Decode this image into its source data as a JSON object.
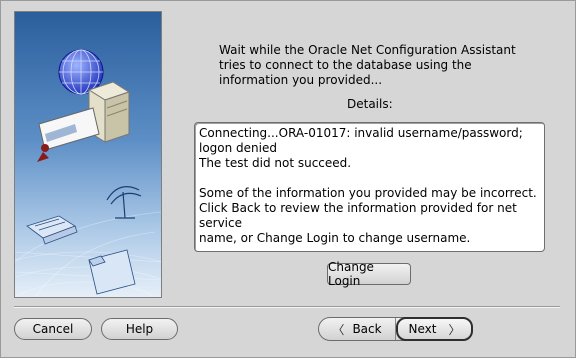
{
  "dialog": {
    "message": "Wait while the Oracle Net Configuration Assistant tries to connect to the database using the information you provided...",
    "details_label": "Details:",
    "details_text": "Connecting...ORA-01017: invalid username/password;\nlogon denied\nThe test did not succeed.\n\nSome of the information you provided may be incorrect.\nClick Back to review the information provided for net service\nname, or Change Login to change username.",
    "change_login_label": "Change Login"
  },
  "footer": {
    "cancel_label": "Cancel",
    "help_label": "Help",
    "back_label": "Back",
    "next_label": "Next",
    "back_icon": "chevron-left-icon",
    "next_icon": "chevron-right-icon"
  },
  "colors": {
    "background": "#d6d6d6",
    "art_blue_dark": "#2b5f9e",
    "art_blue_light": "#cfe0f2"
  }
}
